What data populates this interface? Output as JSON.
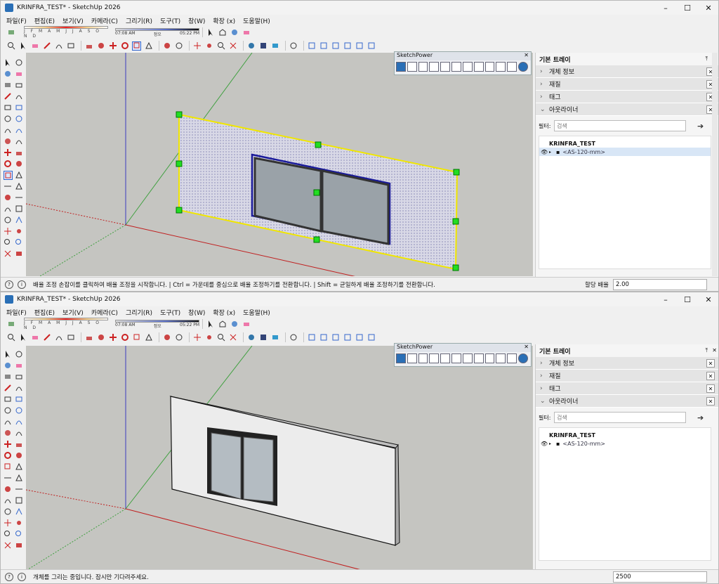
{
  "top": {
    "title": "KRINFRA_TEST* - SketchUp 2026",
    "menu": [
      "파일(F)",
      "편집(E)",
      "보기(V)",
      "카메라(C)",
      "그리기(R)",
      "도구(T)",
      "창(W)",
      "확장 (x)",
      "도움말(H)"
    ],
    "sun_months": "J F M A M J J A S O N D",
    "time_start": "07:08 AM",
    "time_mid": "정오",
    "time_end": "05:22 PM",
    "sketchpower_title": "SketchPower",
    "tray": {
      "title": "기본 트레이",
      "sections": [
        "개체 정보",
        "재질",
        "태그",
        "아웃라이너"
      ],
      "filter_label": "필터:",
      "filter_placeholder": "검색",
      "root": "KRINFRA_TEST",
      "child": "<AS-120-mm>"
    },
    "status": "배율 조정 손잡이를 클릭하여 배율 조정을 시작합니다. | Ctrl = 가운데를 중심으로 배율 조정하기를 전환합니다. | Shift = 균일하게 배율 조정하기를 전환합니다.",
    "vcb_label": "할당 배율",
    "vcb_value": "2.00"
  },
  "bottom": {
    "title": "KRINFRA_TEST* - SketchUp 2026",
    "menu": [
      "파일(F)",
      "편집(E)",
      "보기(V)",
      "카메라(C)",
      "그리기(R)",
      "도구(T)",
      "창(W)",
      "확장 (x)",
      "도움말(H)"
    ],
    "sun_months": "J F M A M J J A S O N D",
    "time_start": "07:08 AM",
    "time_mid": "정오",
    "time_end": "05:22 PM",
    "sketchpower_title": "SketchPower",
    "tray": {
      "title": "기본 트레이",
      "sections": [
        "개체 정보",
        "재질",
        "태그",
        "아웃라이너"
      ],
      "filter_label": "필터:",
      "filter_placeholder": "검색",
      "root": "KRINFRA_TEST",
      "child": "<AS-120-mm>"
    },
    "status": "개체를 그리는 중입니다. 잠시만 기다려주세요.",
    "vcb_value": "2500"
  },
  "colors": {
    "selection": "#f0e600",
    "grip": "#22dd22",
    "bluebox": "#1a1a9a",
    "red_axis": "#c02020",
    "green_axis": "#30a030",
    "blue_axis": "#3030c0"
  }
}
